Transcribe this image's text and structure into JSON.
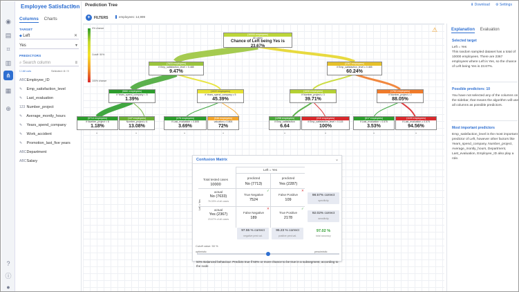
{
  "app": {
    "title": "Employee Satisfaction"
  },
  "left": {
    "tabs": [
      "Columns",
      "Charts"
    ],
    "target_label": "TARGET",
    "target_field": "Left",
    "target_value": "Yes",
    "predictors_label": "PREDICTORS",
    "search_placeholder": "Search column",
    "all_cols": "All cols",
    "selected": "Selected: 8 / 9",
    "predictors": [
      "Employee_ID",
      "Emp_satisfaction_level",
      "Last_evaluation",
      "Number_project",
      "Average_montly_hours",
      "Years_spend_company",
      "Work_accident",
      "Promotion_last_five years",
      "Department",
      "Salary"
    ]
  },
  "header": {
    "title": "Prediction Tree",
    "download": "Download",
    "settings": "Settings",
    "filters": "FILTERS",
    "employees": "employees: 14,999"
  },
  "scale": {
    "top": "0% chance",
    "mid": "Cutoff: 50%",
    "bottom": "100% chance"
  },
  "tree": {
    "root": {
      "count": "(10000 employees)",
      "line1": "All cases",
      "line2": "Chance of Left being Yes is 23.67%"
    },
    "nodes": [
      {
        "id": "n1",
        "count": "(7633 employees)",
        "cond": "if Emp_satisfaction_level > 0.465",
        "value": "9.47%",
        "color": "#9bc53d"
      },
      {
        "id": "n2",
        "count": "(2367 employees)",
        "cond": "if Emp_satisfaction_level ≤ 0.465",
        "value": "60.24%",
        "color": "#e6c12a"
      },
      {
        "id": "n3",
        "count": "(5661 employees)",
        "cond": "if Years_spend_company < 5",
        "value": "1.39%",
        "color": "#2c9d2c"
      },
      {
        "id": "n4",
        "count": "(1022 employees)",
        "cond": "if Years_spend_company ≥ 5",
        "value": "45.39%",
        "color": "#e7e233"
      },
      {
        "id": "n5",
        "count": "(1608 employees)",
        "cond": "if Number_project ≥ 3",
        "value": "39.71%",
        "color": "#b5d133"
      },
      {
        "id": "n6",
        "count": "(1750 employees)",
        "cond": "if Number_project ≥ 2",
        "value": "88.05%",
        "color": "#f07b2a"
      },
      {
        "id": "n7",
        "count": "(5714 employees)",
        "cond": "if Number_project < 6",
        "value": "1.18%",
        "color": "#2c9d2c"
      },
      {
        "id": "n8",
        "count": "(147 employees)",
        "cond": "Number_project ≥ 6",
        "value": "13.08%",
        "color": "#6aaf35"
      },
      {
        "id": "n9",
        "count": "(476 employees)",
        "cond": "if Last_evaluation < 0.805",
        "value": "3.69%",
        "color": "#2c9d2c"
      },
      {
        "id": "n10",
        "count": "(546 employees)",
        "cond": "valuation ≥ 0.805",
        "value": "72%",
        "color": "#f4a52a"
      },
      {
        "id": "n11",
        "count": "(1298 employees)",
        "cond": "if Emp_satisfaction",
        "value": "6.64",
        "color": "#4aa83a"
      },
      {
        "id": "n12",
        "count": "(310 employees)",
        "cond": "if Emp_satisfaction_level < 0.115",
        "value": "100%",
        "color": "#d9292c"
      },
      {
        "id": "n13",
        "count": "(617 employees)",
        "cond": "if Last_evaluation < 0.575",
        "value": "3.53%",
        "color": "#2c9d2c"
      },
      {
        "id": "n14",
        "count": "(1109 employees)",
        "cond": "if Last_evaluation ≥ 0.575",
        "value": "94.56%",
        "color": "#d9292c"
      }
    ]
  },
  "confusion": {
    "title": "Confusion Matrix",
    "header": "Left = Yes",
    "side": "Left = Yes",
    "total_label": "Total tested cases",
    "total": "10000",
    "pred_label": "predicted",
    "pred_no": "No (7713)",
    "pred_yes": "Yes (2287)",
    "actual_label": "actual",
    "act_no": "No (7633)",
    "act_no_pct": "76.33% of all cases",
    "act_yes": "Yes (2367)",
    "act_yes_pct": "23.67% of all cases",
    "tn_label": "True Negative",
    "tn": "7524",
    "fp_label": "False Positive",
    "fp": "109",
    "fn_label": "False Negative",
    "fn": "189",
    "tp_label": "True Positive",
    "tp": "2178",
    "spec": "98.57% correct",
    "spec_label": "specificity",
    "sens": "92.02% correct",
    "sens_label": "sensitivity",
    "npv": "97.55 % correct",
    "npv_label": "negative pred.val.",
    "ppv": "95.23 % correct",
    "ppv_label": "positive pred.val.",
    "acc": "97.02 %",
    "acc_label": "total accuracy",
    "cutoff": "Cutoff value: 50 %",
    "optimistic": "optimistic",
    "pessimistic": "pessimistic",
    "note": "50% Balanced behaviour. Predicts true if 50% or more chance to be true in a subsegment, according to the node"
  },
  "right": {
    "tabs": [
      "Explanation",
      "Evaluation"
    ],
    "selected_title": "Selected target",
    "selected_target": "Left = Yes",
    "selected_text": "This random sampled dataset has a total of 10000 employees. There are 2367 employees where Left is Yes, so the chance of Left being Yes is 23.67%.",
    "possible_title": "Possible predictors: 10",
    "possible_text": "You have not selected any of the columns on the sidebar, that means the algorithm will use all columns as possible predictors.",
    "important_title": "Most important predictors",
    "important_text": "Emp_satisfaction_level is the most important predictor of Left, however other factors like Years_spend_company, Number_project, Average_montly_hours, Department, Last_evaluation, Employee_ID also play a role."
  }
}
